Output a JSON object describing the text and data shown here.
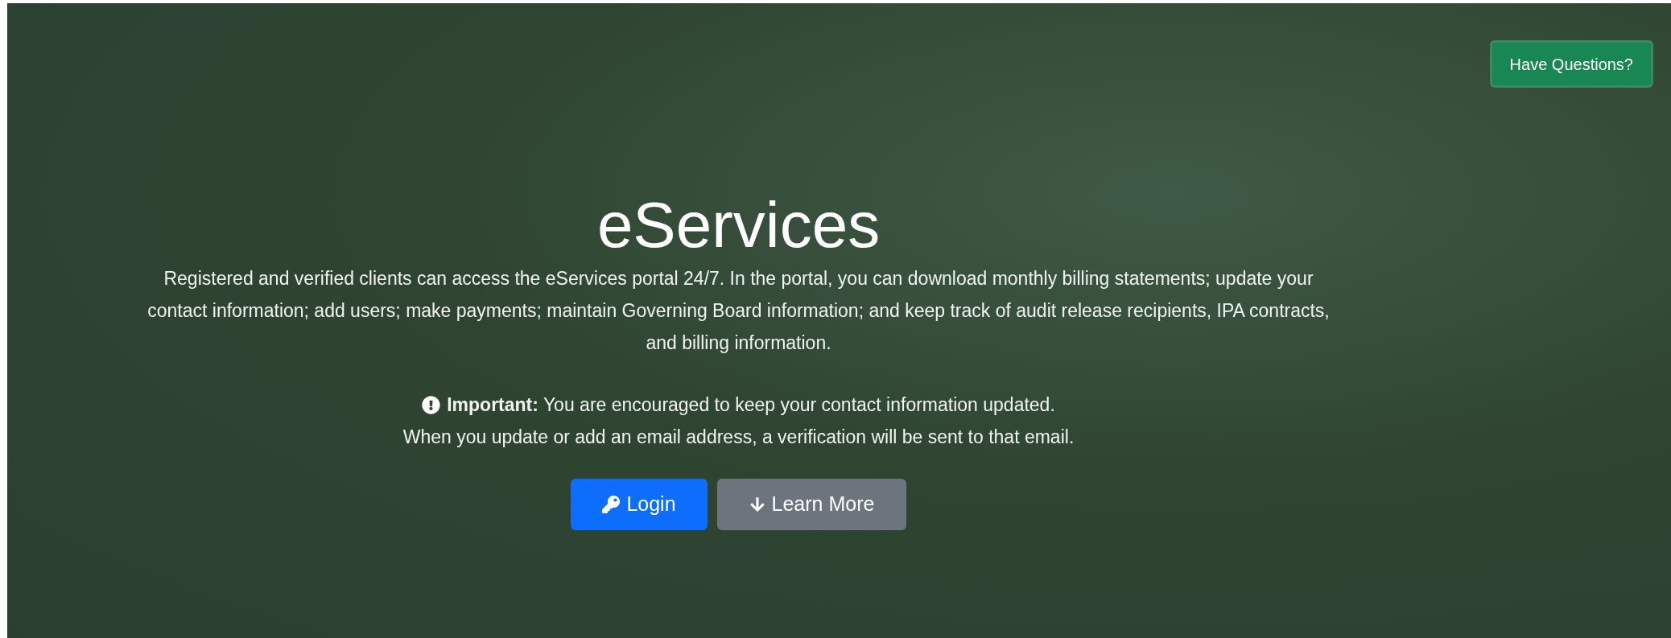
{
  "help_button": {
    "label": "Have Questions?"
  },
  "hero": {
    "title": "eServices",
    "description": "Registered and verified clients can access the eServices portal 24/7. In the portal, you can download monthly billing statements; update your contact information; add users; make payments; maintain Governing Board information; and keep track of audit release recipients, IPA contracts, and billing information.",
    "notice": "**Important:** You are encouraged to keep your contact information updated.",
    "notice_detail": "When you update or add an email address, a verification will be sent to that email.",
    "buttons": [
      {
        "label": "Login",
        "kind": "primary"
      },
      {
        "label": "Learn More",
        "kind": "secondary"
      }
    ]
  }
}
